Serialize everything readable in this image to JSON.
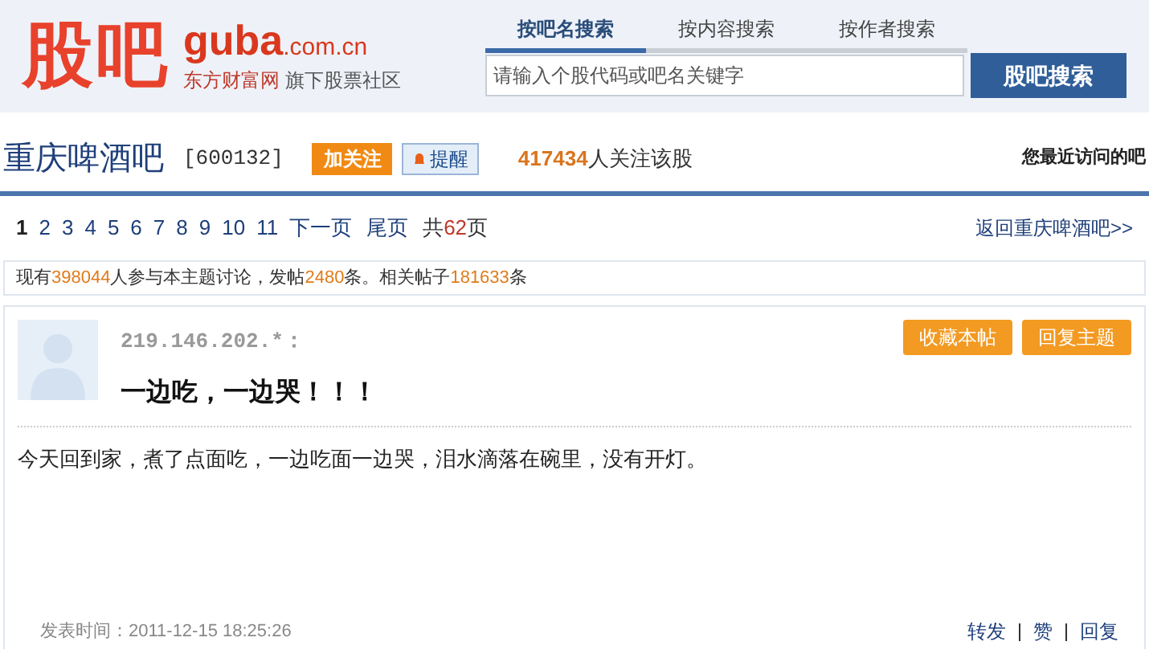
{
  "header": {
    "logo": {
      "mark": "股吧",
      "domain": "guba",
      "tld": ".com.cn",
      "company": "东方财富网",
      "slogan": "旗下股票社区"
    },
    "search_tabs": [
      {
        "label": "按吧名搜索",
        "selected": true
      },
      {
        "label": "按内容搜索",
        "selected": false
      },
      {
        "label": "按作者搜索",
        "selected": false
      }
    ],
    "search": {
      "placeholder": "请输入个股代码或吧名关键字",
      "button": "股吧搜索"
    }
  },
  "bar": {
    "title": "重庆啤酒吧",
    "code": "[600132]",
    "follow_button": "加关注",
    "remind_button": "提醒",
    "followers": "417434",
    "followers_label": "人关注该股",
    "recent": "您最近访问的吧"
  },
  "pagination": {
    "pages": [
      {
        "label": "1",
        "selected": true
      },
      {
        "label": "2",
        "selected": false
      },
      {
        "label": "3",
        "selected": false
      },
      {
        "label": "4",
        "selected": false
      },
      {
        "label": "5",
        "selected": false
      },
      {
        "label": "6",
        "selected": false
      },
      {
        "label": "7",
        "selected": false
      },
      {
        "label": "8",
        "selected": false
      },
      {
        "label": "9",
        "selected": false
      },
      {
        "label": "10",
        "selected": false
      },
      {
        "label": "11",
        "selected": false
      }
    ],
    "next": "下一页",
    "last": "尾页",
    "total": [
      {
        "text": "共",
        "highlight": false
      },
      {
        "text": "62",
        "highlight": true
      },
      {
        "text": "页",
        "highlight": false
      }
    ],
    "back_link": "返回重庆啤酒吧>>"
  },
  "stats": [
    {
      "text": "现有",
      "highlight": false
    },
    {
      "text": "398044",
      "highlight": true
    },
    {
      "text": "人参与本主题讨论，发帖",
      "highlight": false
    },
    {
      "text": "2480",
      "highlight": true
    },
    {
      "text": "条。",
      "highlight": false
    },
    {
      "text": "相关帖子",
      "highlight": false
    },
    {
      "text": "181633",
      "highlight": true
    },
    {
      "text": "条",
      "highlight": false
    }
  ],
  "post": {
    "author": "219.146.202.*：",
    "title": "一边吃，一边哭！！！",
    "buttons": [
      "收藏本帖",
      "回复主题"
    ],
    "body": "今天回到家，煮了点面吃，一边吃面一边哭，泪水滴落在碗里，没有开灯。",
    "time": "发表时间：2011-12-15 18:25:26",
    "actions": [
      "转发",
      "赞",
      "回复"
    ]
  }
}
